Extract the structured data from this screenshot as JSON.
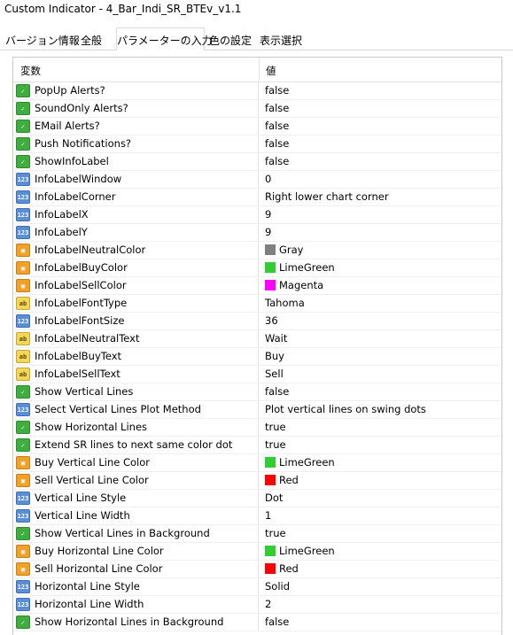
{
  "window": {
    "title": "Custom Indicator - 4_Bar_Indi_SR_BTEv_v1.1"
  },
  "tabs": [
    "バージョン情報",
    "全般",
    "パラメーターの入力",
    "色の設定",
    "表示選択"
  ],
  "active_tab": "パラメーターの入力",
  "grid": {
    "col_variable": "変数",
    "col_value": "値",
    "rows": [
      {
        "type": "bool",
        "icon": "bool-icon",
        "name": "PopUp Alerts?",
        "value": "false"
      },
      {
        "type": "bool",
        "icon": "bool-icon",
        "name": "SoundOnly Alerts?",
        "value": "false"
      },
      {
        "type": "bool",
        "icon": "bool-icon",
        "name": "EMail Alerts?",
        "value": "false"
      },
      {
        "type": "bool",
        "icon": "bool-icon",
        "name": "Push Notifications?",
        "value": "false"
      },
      {
        "type": "bool",
        "icon": "bool-icon",
        "name": "ShowInfoLabel",
        "value": "false"
      },
      {
        "type": "num",
        "icon": "int-icon",
        "name": "InfoLabelWindow",
        "value": "0"
      },
      {
        "type": "enm",
        "icon": "enum-icon",
        "name": "InfoLabelCorner",
        "value": "Right lower chart corner"
      },
      {
        "type": "num",
        "icon": "int-icon",
        "name": "InfoLabelX",
        "value": "9"
      },
      {
        "type": "num",
        "icon": "int-icon",
        "name": "InfoLabelY",
        "value": "9"
      },
      {
        "type": "clr",
        "icon": "color-icon",
        "name": "InfoLabelNeutralColor",
        "value": "Gray",
        "color": "#808080"
      },
      {
        "type": "clr",
        "icon": "color-icon",
        "name": "InfoLabelBuyColor",
        "value": "LimeGreen",
        "color": "#32cd32"
      },
      {
        "type": "clr",
        "icon": "color-icon",
        "name": "InfoLabelSellColor",
        "value": "Magenta",
        "color": "#ff00ff"
      },
      {
        "type": "str",
        "icon": "string-icon",
        "name": "InfoLabelFontType",
        "value": "Tahoma"
      },
      {
        "type": "num",
        "icon": "int-icon",
        "name": "InfoLabelFontSize",
        "value": "36"
      },
      {
        "type": "str",
        "icon": "string-icon",
        "name": "InfoLabelNeutralText",
        "value": "Wait"
      },
      {
        "type": "str",
        "icon": "string-icon",
        "name": "InfoLabelBuyText",
        "value": "Buy"
      },
      {
        "type": "str",
        "icon": "string-icon",
        "name": "InfoLabelSellText",
        "value": "Sell"
      },
      {
        "type": "bool",
        "icon": "bool-icon",
        "name": "Show Vertical Lines",
        "value": "false"
      },
      {
        "type": "enm",
        "icon": "enum-icon",
        "name": "Select Vertical Lines Plot Method",
        "value": "Plot vertical lines on swing dots"
      },
      {
        "type": "bool",
        "icon": "bool-icon",
        "name": "Show Horizontal Lines",
        "value": "true"
      },
      {
        "type": "bool",
        "icon": "bool-icon",
        "name": "Extend SR lines to next same color dot",
        "value": "true"
      },
      {
        "type": "clr",
        "icon": "color-icon",
        "name": "Buy Vertical Line Color",
        "value": "LimeGreen",
        "color": "#32cd32"
      },
      {
        "type": "clr",
        "icon": "color-icon",
        "name": "Sell Vertical Line Color",
        "value": "Red",
        "color": "#ff0000"
      },
      {
        "type": "enm",
        "icon": "enum-icon",
        "name": "Vertical Line Style",
        "value": "Dot"
      },
      {
        "type": "num",
        "icon": "int-icon",
        "name": "Vertical Line Width",
        "value": "1"
      },
      {
        "type": "bool",
        "icon": "bool-icon",
        "name": "Show Vertical Lines in Background",
        "value": "true"
      },
      {
        "type": "clr",
        "icon": "color-icon",
        "name": "Buy Horizontal Line Color",
        "value": "LimeGreen",
        "color": "#32cd32"
      },
      {
        "type": "clr",
        "icon": "color-icon",
        "name": "Sell Horizontal Line Color",
        "value": "Red",
        "color": "#ff0000"
      },
      {
        "type": "enm",
        "icon": "enum-icon",
        "name": "Horizontal Line Style",
        "value": "Solid"
      },
      {
        "type": "num",
        "icon": "int-icon",
        "name": "Horizontal Line Width",
        "value": "2"
      },
      {
        "type": "bool",
        "icon": "bool-icon",
        "name": "Show Horizontal Lines in Background",
        "value": "false"
      }
    ]
  }
}
